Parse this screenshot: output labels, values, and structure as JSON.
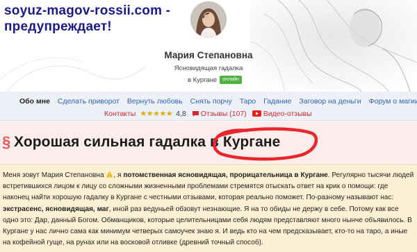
{
  "site": {
    "watermark_line1": "soyuz-magov-rossii.com -",
    "watermark_line2": "предупреждает!"
  },
  "profile": {
    "name": "Мария Степановна",
    "role": "Ясновидящая гадалка",
    "city": "в Кургане",
    "status": "онлайн"
  },
  "nav": {
    "row1": [
      "Обо мне",
      "Сделать приворот",
      "Вернуть любовь",
      "Снять порчу",
      "Таро",
      "Гадание",
      "Заговор на деньги",
      "Форум о магии"
    ],
    "contacts": "Контакты",
    "stars": "★★★★★",
    "rating": "4,8",
    "reviews": "Отзывы (107)",
    "video_reviews": "Видео-отзывы"
  },
  "title": {
    "mark": "§",
    "text": "Хорошая сильная гадалка в Кургане"
  },
  "body": {
    "t1": "Меня зовут Мария Степановна ",
    "t2": ", я ",
    "b1": "потомственная ясновидящая, прорицательница в Кургане",
    "t3": ". Регулярно тысячи людей встретившихся лицом к лицу со сложными жизненными проблемами стремятся отыскать ответ на крик о помощи: где наконец найти хорошую гадалку в Кургане с честными отзывами, которая реально поможет. По-разному называют нас: ",
    "b2": "экстрасенс, ясновидящая, маг",
    "t4": ", иной раз ведуньей обзовут незнающие. Я на то обиды не держу в себе. Потому как все одно это: Дар, данный Богом. Обманщиков, которые целительницами себя людям представляют много нынче объявилось. В Кургане у нас лично сама как минимум четверых самоучек знаю я. И ведь кто на чем предсказывает, кто-то на таро, а иные на кофейной гуще, на рунах или на восковой отливке (древний точный способ)."
  },
  "colors": {
    "link": "#2e63b1",
    "red_link": "#d2292b",
    "online": "#4fb342",
    "title_bg": "#fdecec",
    "body_bg": "#fcefd3",
    "watermark": "#1a1a8c",
    "circle": "#e8262c"
  }
}
